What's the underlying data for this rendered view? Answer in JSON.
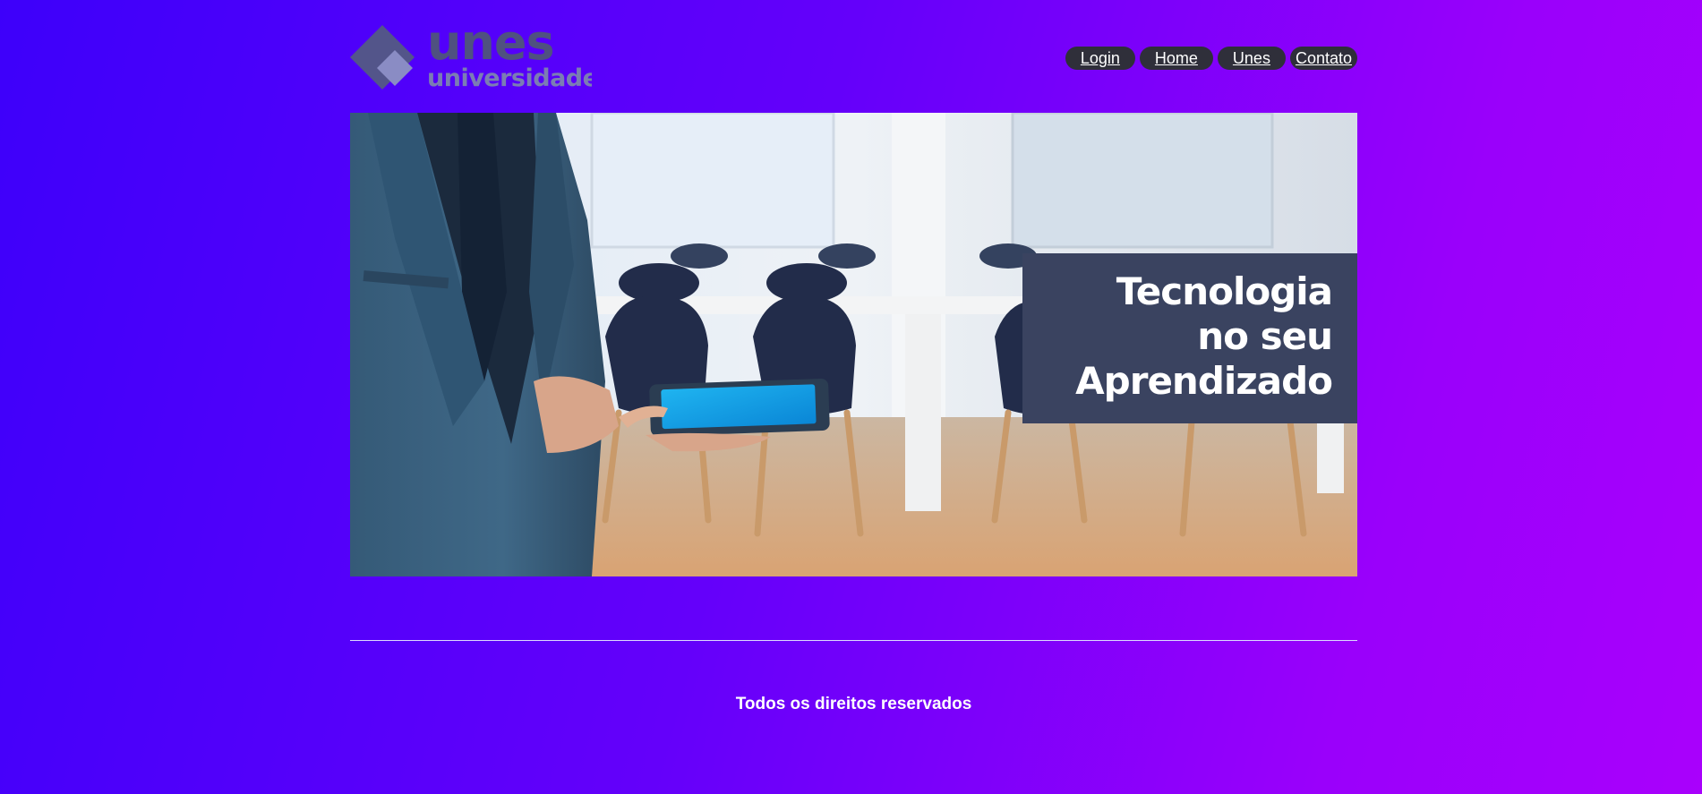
{
  "header": {
    "logo": {
      "wordmark": "unes",
      "subtitle": "universidade"
    },
    "nav": [
      {
        "label": "Login"
      },
      {
        "label": "Home"
      },
      {
        "label": "Unes"
      },
      {
        "label": "Contato"
      }
    ]
  },
  "banner": {
    "caption_line1": "Tecnologia",
    "caption_line2": "no seu",
    "caption_line3": "Aprendizado"
  },
  "footer": {
    "text": "Todos os direitos reservados"
  },
  "colors": {
    "background_start": "#3d00fa",
    "background_end": "#a900fc",
    "nav_button": "#2f2f3a",
    "caption_panel": "#3a4360",
    "logo_primary": "#525582",
    "logo_secondary": "#7d7fb6"
  }
}
